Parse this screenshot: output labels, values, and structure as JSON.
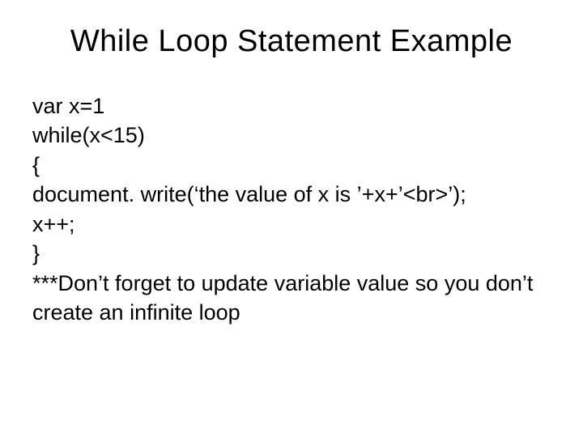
{
  "title": "While Loop Statement Example",
  "lines": {
    "l0": "var x=1",
    "l1": "while(x<15)",
    "l2": "{",
    "l3": "document. write(‘the value of x is ’+x+’<br>’);",
    "l4": "x++;",
    "l5": "}",
    "l6": "***Don’t forget to update variable value so you don’t create an infinite loop"
  }
}
